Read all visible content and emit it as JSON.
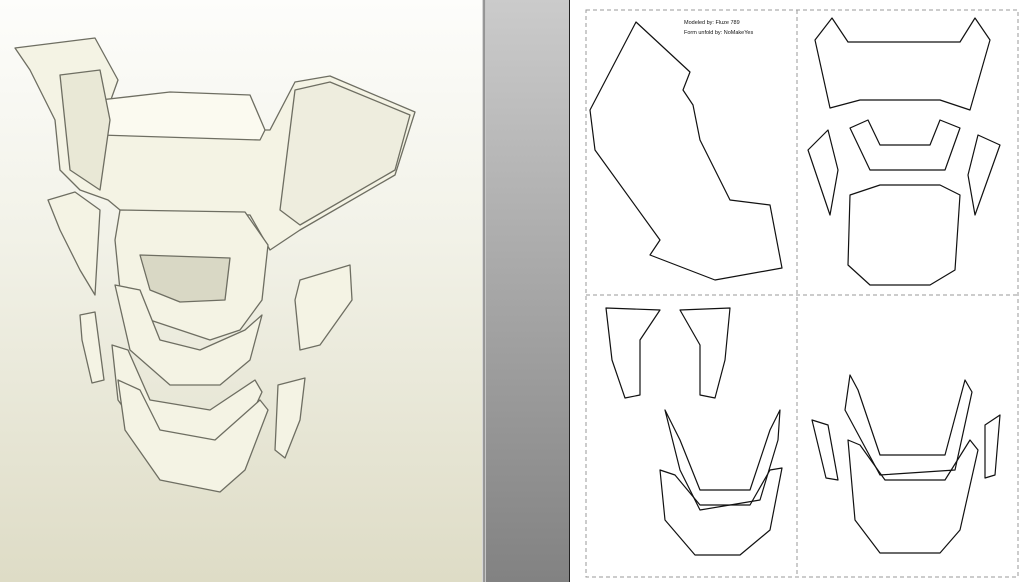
{
  "view3d": {
    "label": "3D model view"
  },
  "unfold": {
    "credits": {
      "modeled_by": "Modeled by: Fluze 789",
      "unfold_by": "Form unfold by: NoMakeYes"
    }
  },
  "colors": {
    "model_face": "#f4f3e4",
    "model_edge": "#6e6e62",
    "page_bg": "#ffffff"
  }
}
